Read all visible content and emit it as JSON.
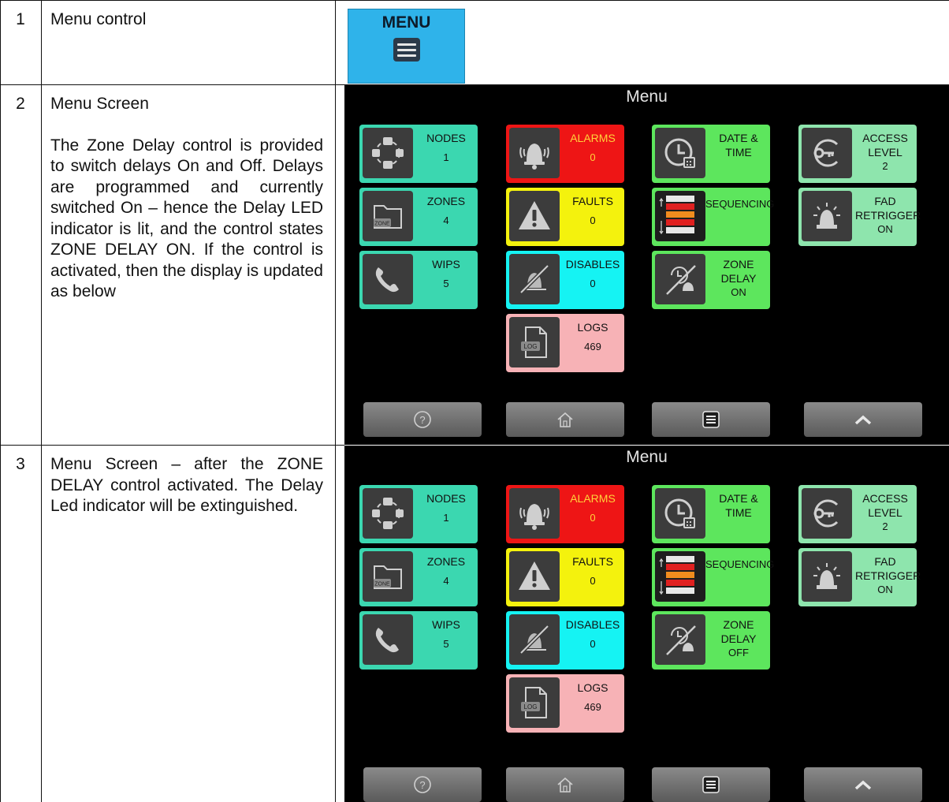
{
  "rows": [
    {
      "num": "1",
      "title": "Menu control"
    },
    {
      "num": "2",
      "title": "Menu Screen",
      "body": "The Zone Delay control is provided to switch delays On and Off. Delays are programmed and currently switched On – hence the Delay LED indicator is lit, and the control states ZONE DELAY ON. If the control is activated, then the display is updated as below"
    },
    {
      "num": "3",
      "body": "Menu Screen – after the ZONE DELAY control activated. The Delay Led indicator will be extinguished."
    }
  ],
  "menu_button": {
    "label": "MENU",
    "icon": "menu-icon",
    "color": "#2fb3ea"
  },
  "screens": [
    {
      "title": "Menu",
      "tiles": {
        "nodes": {
          "l1": "NODES",
          "v": "1"
        },
        "alarms": {
          "l1": "ALARMS",
          "v": "0"
        },
        "datetime": {
          "l1": "DATE &",
          "l2": "TIME"
        },
        "access": {
          "l1": "ACCESS",
          "l2": "LEVEL",
          "v": "2"
        },
        "zones": {
          "l1": "ZONES",
          "v": "4",
          "icon_text": "ZONE"
        },
        "faults": {
          "l1": "FAULTS",
          "v": "0"
        },
        "sequencing": {
          "l1": "SEQUENCING"
        },
        "fad": {
          "l1": "FAD",
          "l2": "RETRIGGER",
          "v": "ON"
        },
        "wips": {
          "l1": "WIPS",
          "v": "5"
        },
        "disables": {
          "l1": "DISABLES",
          "v": "0"
        },
        "zonedelay": {
          "l1": "ZONE",
          "l2": "DELAY",
          "v": "ON"
        },
        "logs": {
          "l1": "LOGS",
          "v": "469",
          "icon_text": "LOG"
        }
      }
    },
    {
      "title": "Menu",
      "tiles": {
        "nodes": {
          "l1": "NODES",
          "v": "1"
        },
        "alarms": {
          "l1": "ALARMS",
          "v": "0"
        },
        "datetime": {
          "l1": "DATE &",
          "l2": "TIME"
        },
        "access": {
          "l1": "ACCESS",
          "l2": "LEVEL",
          "v": "2"
        },
        "zones": {
          "l1": "ZONES",
          "v": "4",
          "icon_text": "ZONE"
        },
        "faults": {
          "l1": "FAULTS",
          "v": "0"
        },
        "sequencing": {
          "l1": "SEQUENCING"
        },
        "fad": {
          "l1": "FAD",
          "l2": "RETRIGGER",
          "v": "ON"
        },
        "wips": {
          "l1": "WIPS",
          "v": "5"
        },
        "disables": {
          "l1": "DISABLES",
          "v": "0"
        },
        "zonedelay": {
          "l1": "ZONE",
          "l2": "DELAY",
          "v": "OFF"
        },
        "logs": {
          "l1": "LOGS",
          "v": "469",
          "icon_text": "LOG"
        }
      }
    }
  ],
  "nav_icons": [
    "help-icon",
    "home-icon",
    "menu-icon",
    "chevron-up-icon"
  ],
  "colors": {
    "teal": "#3bd7b0",
    "red": "#ee1515",
    "green": "#5de65d",
    "mint": "#8ee5ad",
    "yellow": "#f4f20d",
    "cyan": "#15f3f3",
    "pink": "#f7b2b6"
  }
}
